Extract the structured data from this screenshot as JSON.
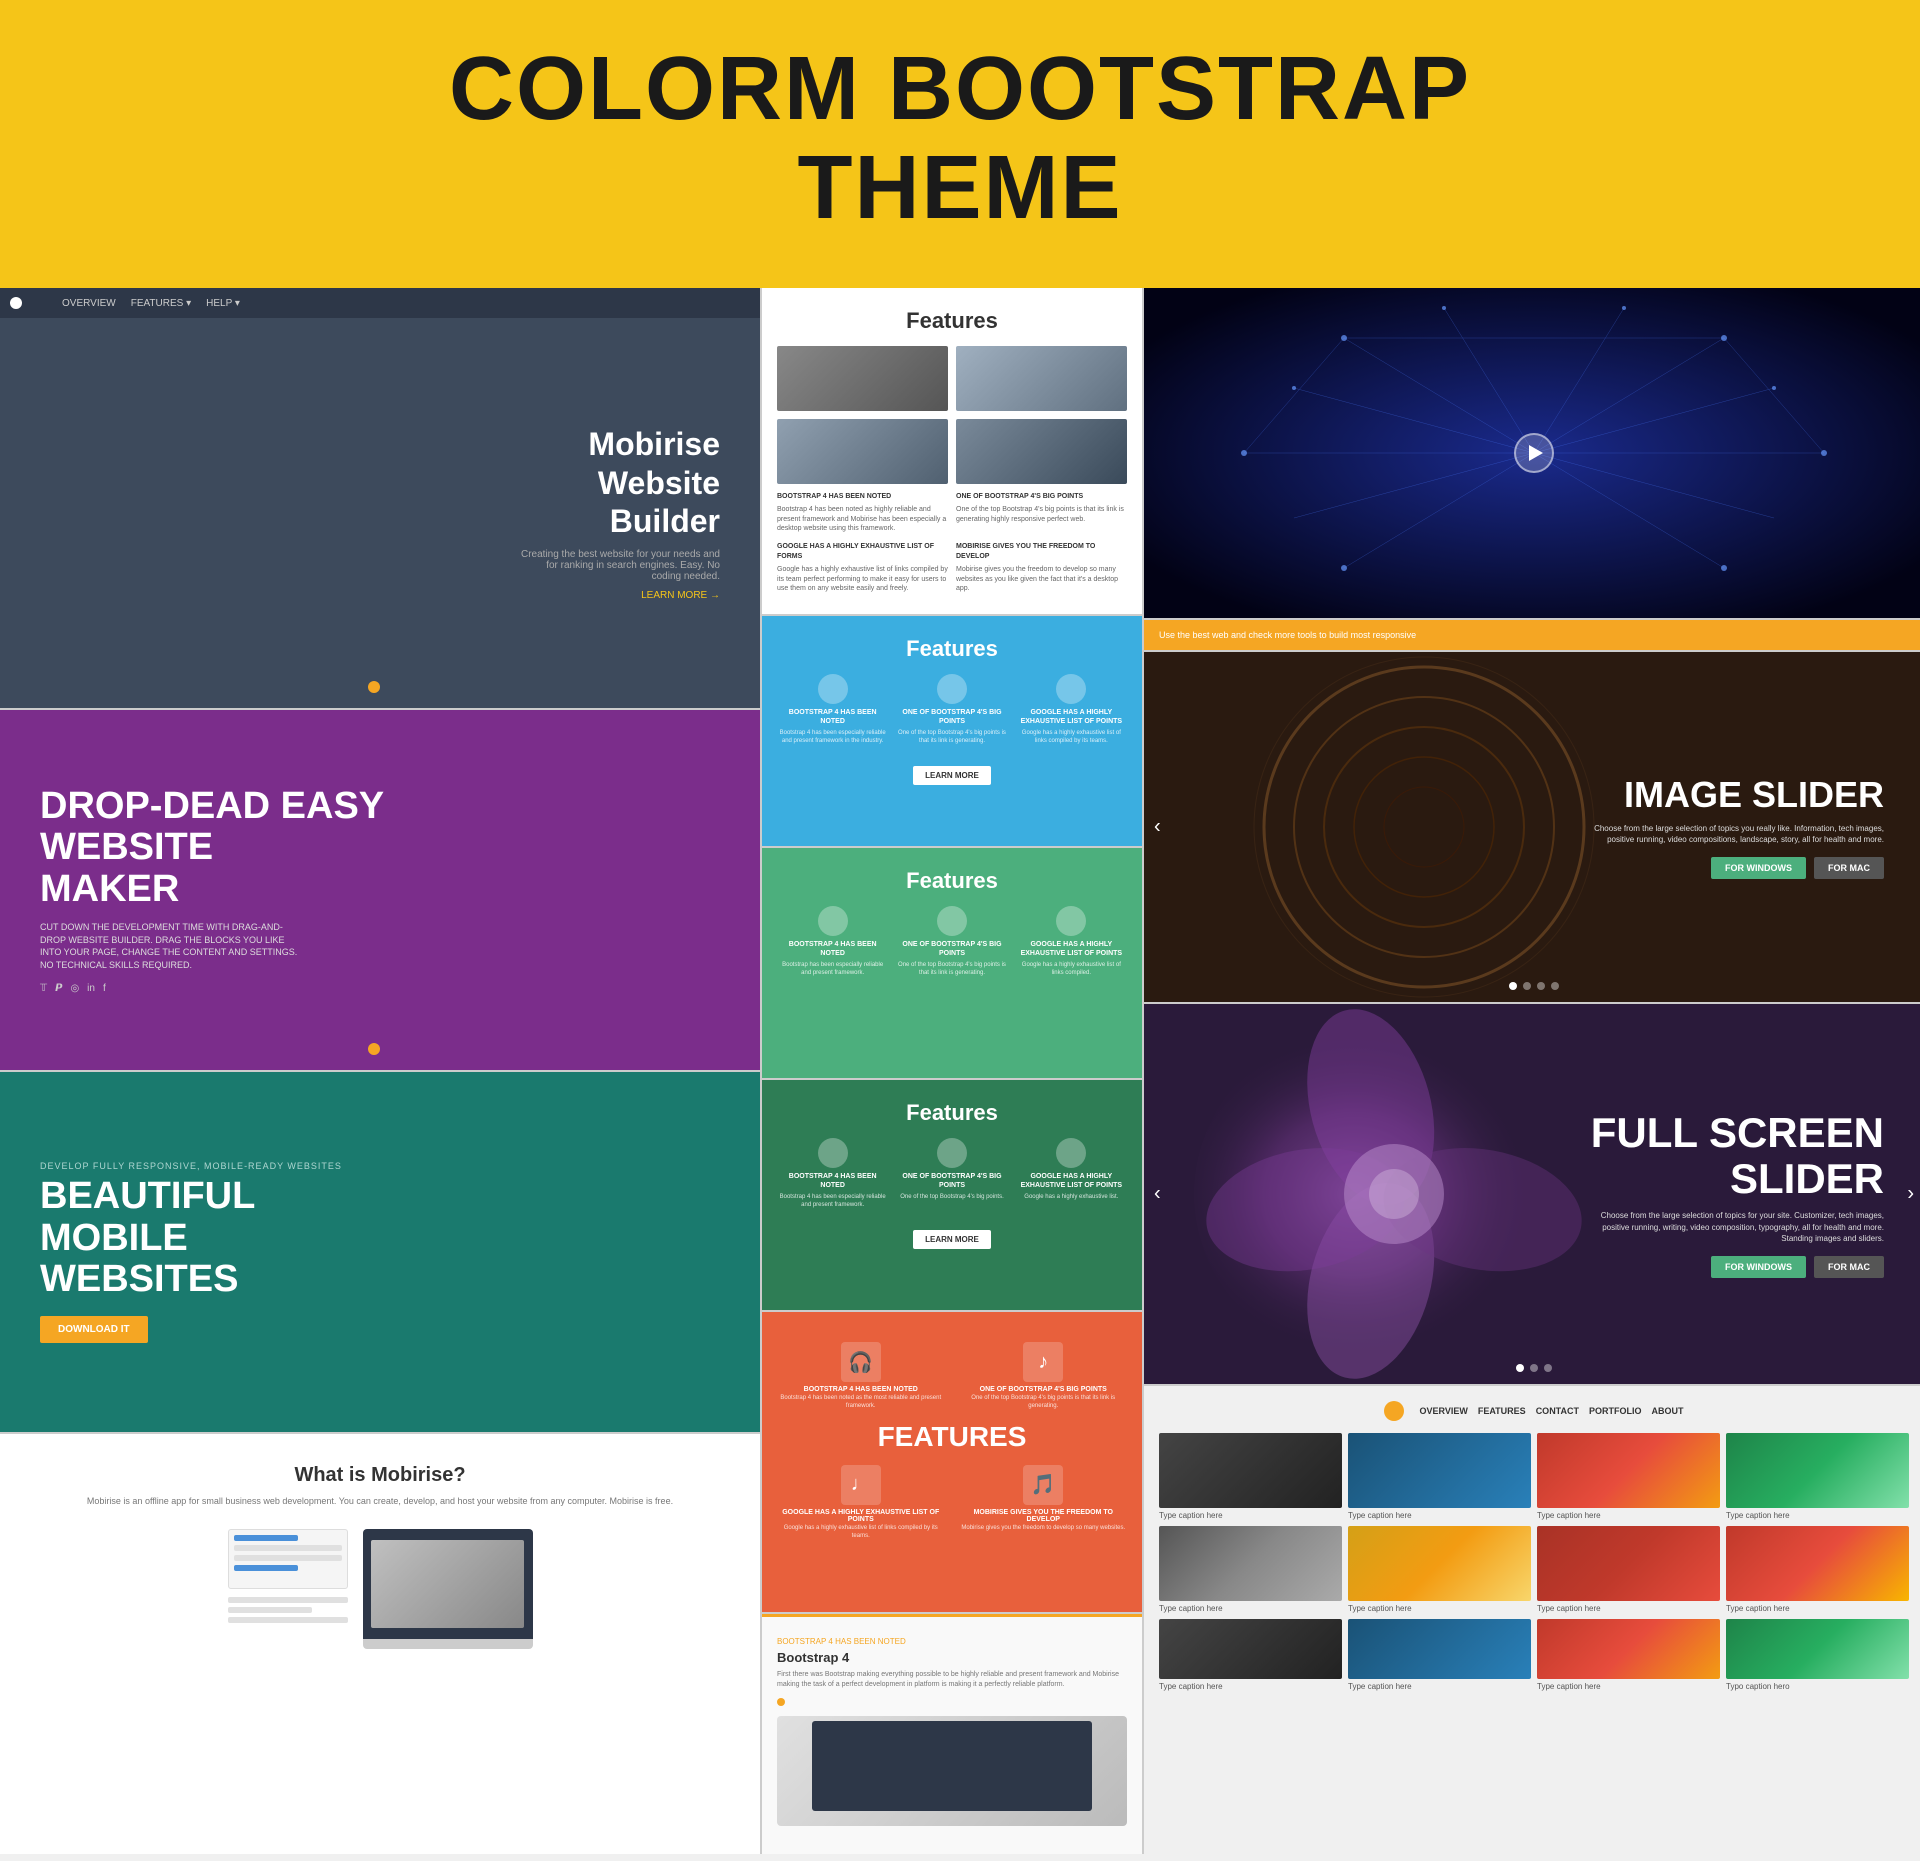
{
  "header": {
    "title_line1": "COLORM BOOTSTRAP",
    "title_line2": "THEME"
  },
  "left_col": {
    "website_builder": {
      "nav": {
        "items": [
          "OVERVIEW",
          "FEATURES ▾",
          "HELP ▾"
        ]
      },
      "title": "Mobirise\nWebsite\nBuilder",
      "description": "Creating the best website for your needs and for ranking in search engines. Easy. No coding needed.",
      "learn_more": "LEARN MORE →"
    },
    "purple": {
      "title": "DROP-DEAD EASY\nWEBSITE\nMAKER",
      "description": "CUT DOWN THE DEVELOPMENT TIME WITH DRAG-AND-DROP WEBSITE BUILDER. DRAG THE BLOCKS YOU LIKE INTO YOUR PAGE, CHANGE THE CONTENT AND SETTINGS. NO TECHNICAL SKILLS REQUIRED.",
      "social_icons": [
        "twitter",
        "pinterest",
        "instagram",
        "linkedin",
        "facebook"
      ]
    },
    "teal": {
      "subtitle": "DEVELOP FULLY RESPONSIVE, MOBILE-READY WEBSITES",
      "title": "BEAUTIFUL\nMOBILE\nWEBSITES",
      "download_btn": "DOWNLOAD IT"
    },
    "what_is": {
      "title": "What is Mobirise?",
      "description": "Mobirise is an offline app for small business web development. You can create, develop, and host your website from any computer. Mobirise is free."
    }
  },
  "mid_col": {
    "features_white": {
      "title": "Features",
      "items": [
        {
          "title": "BOOTSTRAP 4 HAS BEEN NOTED",
          "text": "Bootstrap 4 has been noted as highly reliable and present framework and Mobirise has been especially a desktop website using this framework."
        },
        {
          "title": "ONE OF BOOTSTRAP 4'S BIG POINTS",
          "text": "One of the top Bootstrap 4's big points is that its link is generating highly responsive perfect web."
        },
        {
          "title": "GOOGLE HAS A HIGHLY EXHAUSTIVE LIST OF FORMS",
          "text": "Google has a highly exhaustive list of links compiled by its team perfect performing to make it easy for users to use them on any website easily and freely."
        },
        {
          "title": "MOBIRISE GIVES YOU THE FREEDOM TO DEVELOP",
          "text": "Mobirise gives you the freedom to develop so many websites as you like given the fact that it's a desktop app."
        }
      ]
    },
    "features_blue": {
      "title": "Features",
      "cols": [
        {
          "title": "BOOTSTRAP 4 HAS BEEN NOTED",
          "text": "Bootstrap 4 has been especially reliable and present framework in the industry."
        },
        {
          "title": "ONE OF BOOTSTRAP 4'S BIG POINTS",
          "text": "One of the top Bootstrap 4's big points is that its link is generating."
        },
        {
          "title": "GOOGLE HAS A HIGHLY EXHAUSTIVE LIST OF POINTS",
          "text": "Google has a highly exhaustive list of links compiled by its teams."
        }
      ],
      "btn": "LEARN MORE"
    },
    "features_green": {
      "title": "Features",
      "cols": [
        {
          "title": "BOOTSTRAP 4 HAS BEEN NOTED",
          "text": "Bootstrap has been especially reliable and present framework."
        },
        {
          "title": "ONE OF BOOTSTRAP 4'S BIG POINTS",
          "text": "One of the top Bootstrap 4's big points is that its link is generating."
        },
        {
          "title": "GOOGLE HAS A HIGHLY EXHAUSTIVE LIST OF POINTS",
          "text": "Google has a highly exhaustive list of links compiled."
        }
      ]
    },
    "features_darkgreen": {
      "title": "Features",
      "cols": [
        {
          "title": "BOOTSTRAP 4 HAS BEEN NOTED",
          "text": "Bootstrap 4 has been especially reliable and present framework."
        },
        {
          "title": "ONE OF BOOTSTRAP 4'S BIG POINTS",
          "text": "One of the top Bootstrap 4's big points."
        },
        {
          "title": "GOOGLE HAS A HIGHLY EXHAUSTIVE LIST OF POINTS",
          "text": "Google has a highly exhaustive list."
        }
      ],
      "btn": "LEARN MORE"
    },
    "features_orange": {
      "title": "FEATURES",
      "items": [
        {
          "icon": "🎧",
          "title": "BOOTSTRAP 4 HAS BEEN NOTED",
          "text": "Bootstrap 4 has been noted as the most reliable and present framework."
        },
        {
          "icon": "♪",
          "title": "ONE OF BOOTSTRAP 4'S BIG POINTS",
          "text": "One of the top Bootstrap 4's big points is that its link is generating."
        },
        {
          "icon": "♩",
          "title": "GOOGLE HAS A HIGHLY EXHAUSTIVE LIST OF POINTS",
          "text": "Google has a highly exhaustive list of links compiled by its teams."
        },
        {
          "icon": "🎵",
          "title": "MOBIRISE GIVES YOU THE FREEDOM TO DEVELOP",
          "text": "Mobirise gives you the freedom to develop so many websites."
        }
      ]
    },
    "bootstrap": {
      "subtitle": "BOOTSTRAP 4 HAS BEEN NOTED",
      "title": "Bootstrap 4",
      "text": "First there was Bootstrap making everything possible to be highly reliable and present framework and Mobirise making the task of a perfect development in platform is making it a perfectly reliable platform."
    }
  },
  "right_col": {
    "space": {
      "has_play_btn": true
    },
    "orange_bar": {
      "text": "Use the best web and check more tools to build most responsive"
    },
    "image_slider": {
      "title": "IMAGE SLIDER",
      "description": "Choose from the large selection of topics you really like. Information, tech images, positive running, video compositions, landscape, story, all for health and more.",
      "btn_windows": "FOR WINDOWS",
      "btn_mac": "FOR MAC",
      "dots": [
        true,
        false,
        false,
        false
      ]
    },
    "fullscreen_slider": {
      "title": "FULL SCREEN\nSLIDER",
      "description": "Choose from the large selection of topics for your site. Customizer, tech images, positive running, writing, video composition, typography, all for health and more. Standing images and sliders.",
      "btn_windows": "FOR WINDOWS",
      "btn_mac": "FOR MAC"
    },
    "gallery": {
      "nav_items": [
        "OVERVIEW",
        "FEATURES",
        "CONTACT",
        "PORTFOLIO",
        "ABOUT"
      ],
      "rows": [
        [
          {
            "caption": "Type caption here",
            "color": "gallery-img-1"
          },
          {
            "caption": "Type caption here",
            "color": "gallery-img-2"
          },
          {
            "caption": "Type caption here",
            "color": "gallery-img-3"
          },
          {
            "caption": "Type caption here",
            "color": "gallery-img-4"
          }
        ],
        [
          {
            "caption": "Type caption here",
            "color": "gallery-img-5"
          },
          {
            "caption": "Type caption here",
            "color": "gallery-img-6"
          },
          {
            "caption": "Type caption here",
            "color": "gallery-img-7"
          },
          {
            "caption": "Type caption here",
            "color": "gallery-img-8"
          }
        ],
        [
          {
            "caption": "Type caption here",
            "color": "gallery-img-1"
          },
          {
            "caption": "Type caption here",
            "color": "gallery-img-2"
          },
          {
            "caption": "Type caption here",
            "color": "gallery-img-3"
          },
          {
            "caption": "Typo caption hero",
            "color": "gallery-img-4"
          }
        ]
      ]
    }
  }
}
